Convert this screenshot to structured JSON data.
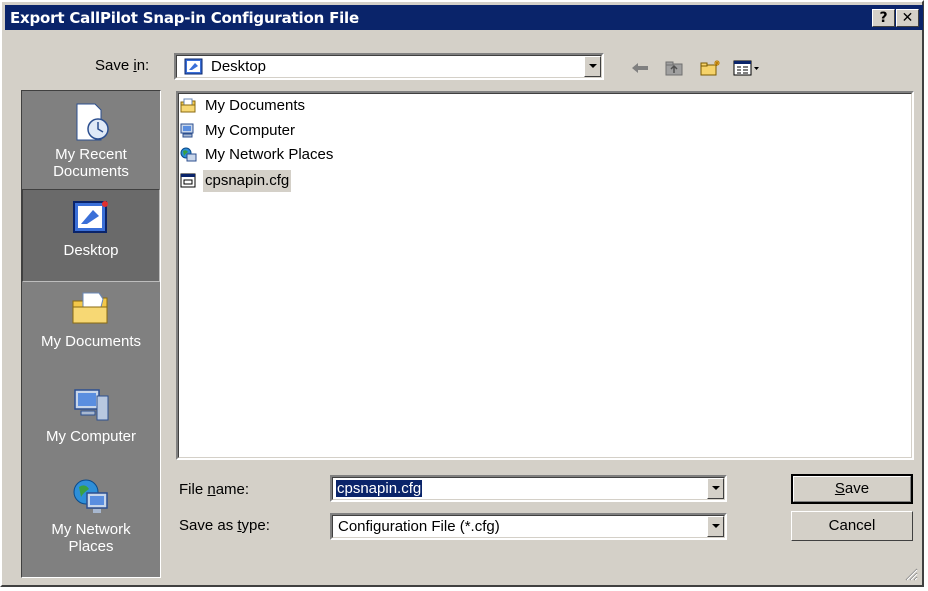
{
  "title": "Export CallPilot Snap-in Configuration File",
  "titlebar_buttons": {
    "help": "?",
    "close": "✕"
  },
  "save_in": {
    "label_pre": "Save ",
    "label_key": "i",
    "label_post": "n:",
    "value": "Desktop"
  },
  "toolbar": {
    "icons": [
      "back-arrow-icon",
      "up-folder-icon",
      "new-folder-icon",
      "view-menu-icon"
    ],
    "view_arrow": "▾"
  },
  "places": [
    {
      "label": "My Recent Documents",
      "line1": "My Recent",
      "line2": "Documents",
      "icon": "recent-documents-icon",
      "selected": false
    },
    {
      "label": "Desktop",
      "line1": "Desktop",
      "line2": "",
      "icon": "desktop-icon",
      "selected": true
    },
    {
      "label": "My Documents",
      "line1": "My Documents",
      "line2": "",
      "icon": "my-documents-icon",
      "selected": false
    },
    {
      "label": "My Computer",
      "line1": "My Computer",
      "line2": "",
      "icon": "my-computer-icon",
      "selected": false
    },
    {
      "label": "My Network Places",
      "line1": "My Network",
      "line2": "Places",
      "icon": "network-places-icon",
      "selected": false
    }
  ],
  "files": [
    {
      "name": "My Documents",
      "icon": "folder-icon",
      "selected": false
    },
    {
      "name": "My Computer",
      "icon": "computer-icon",
      "selected": false
    },
    {
      "name": "My Network Places",
      "icon": "network-icon",
      "selected": false
    },
    {
      "name": "cpsnapin.cfg",
      "icon": "cfg-file-icon",
      "selected": true
    }
  ],
  "file_name": {
    "label_pre": "File ",
    "label_key": "n",
    "label_post": "ame:",
    "value": "cpsnapin.cfg"
  },
  "save_as_type": {
    "label_pre": "Save as ",
    "label_key": "t",
    "label_post": "ype:",
    "value": "Configuration File (*.cfg)"
  },
  "buttons": {
    "save_key": "S",
    "save_rest": "ave",
    "cancel": "Cancel"
  },
  "colors": {
    "titlebar": "#0a246a",
    "face": "#d4d0c8",
    "places_bar": "#808080",
    "selection": "#0a246a"
  }
}
